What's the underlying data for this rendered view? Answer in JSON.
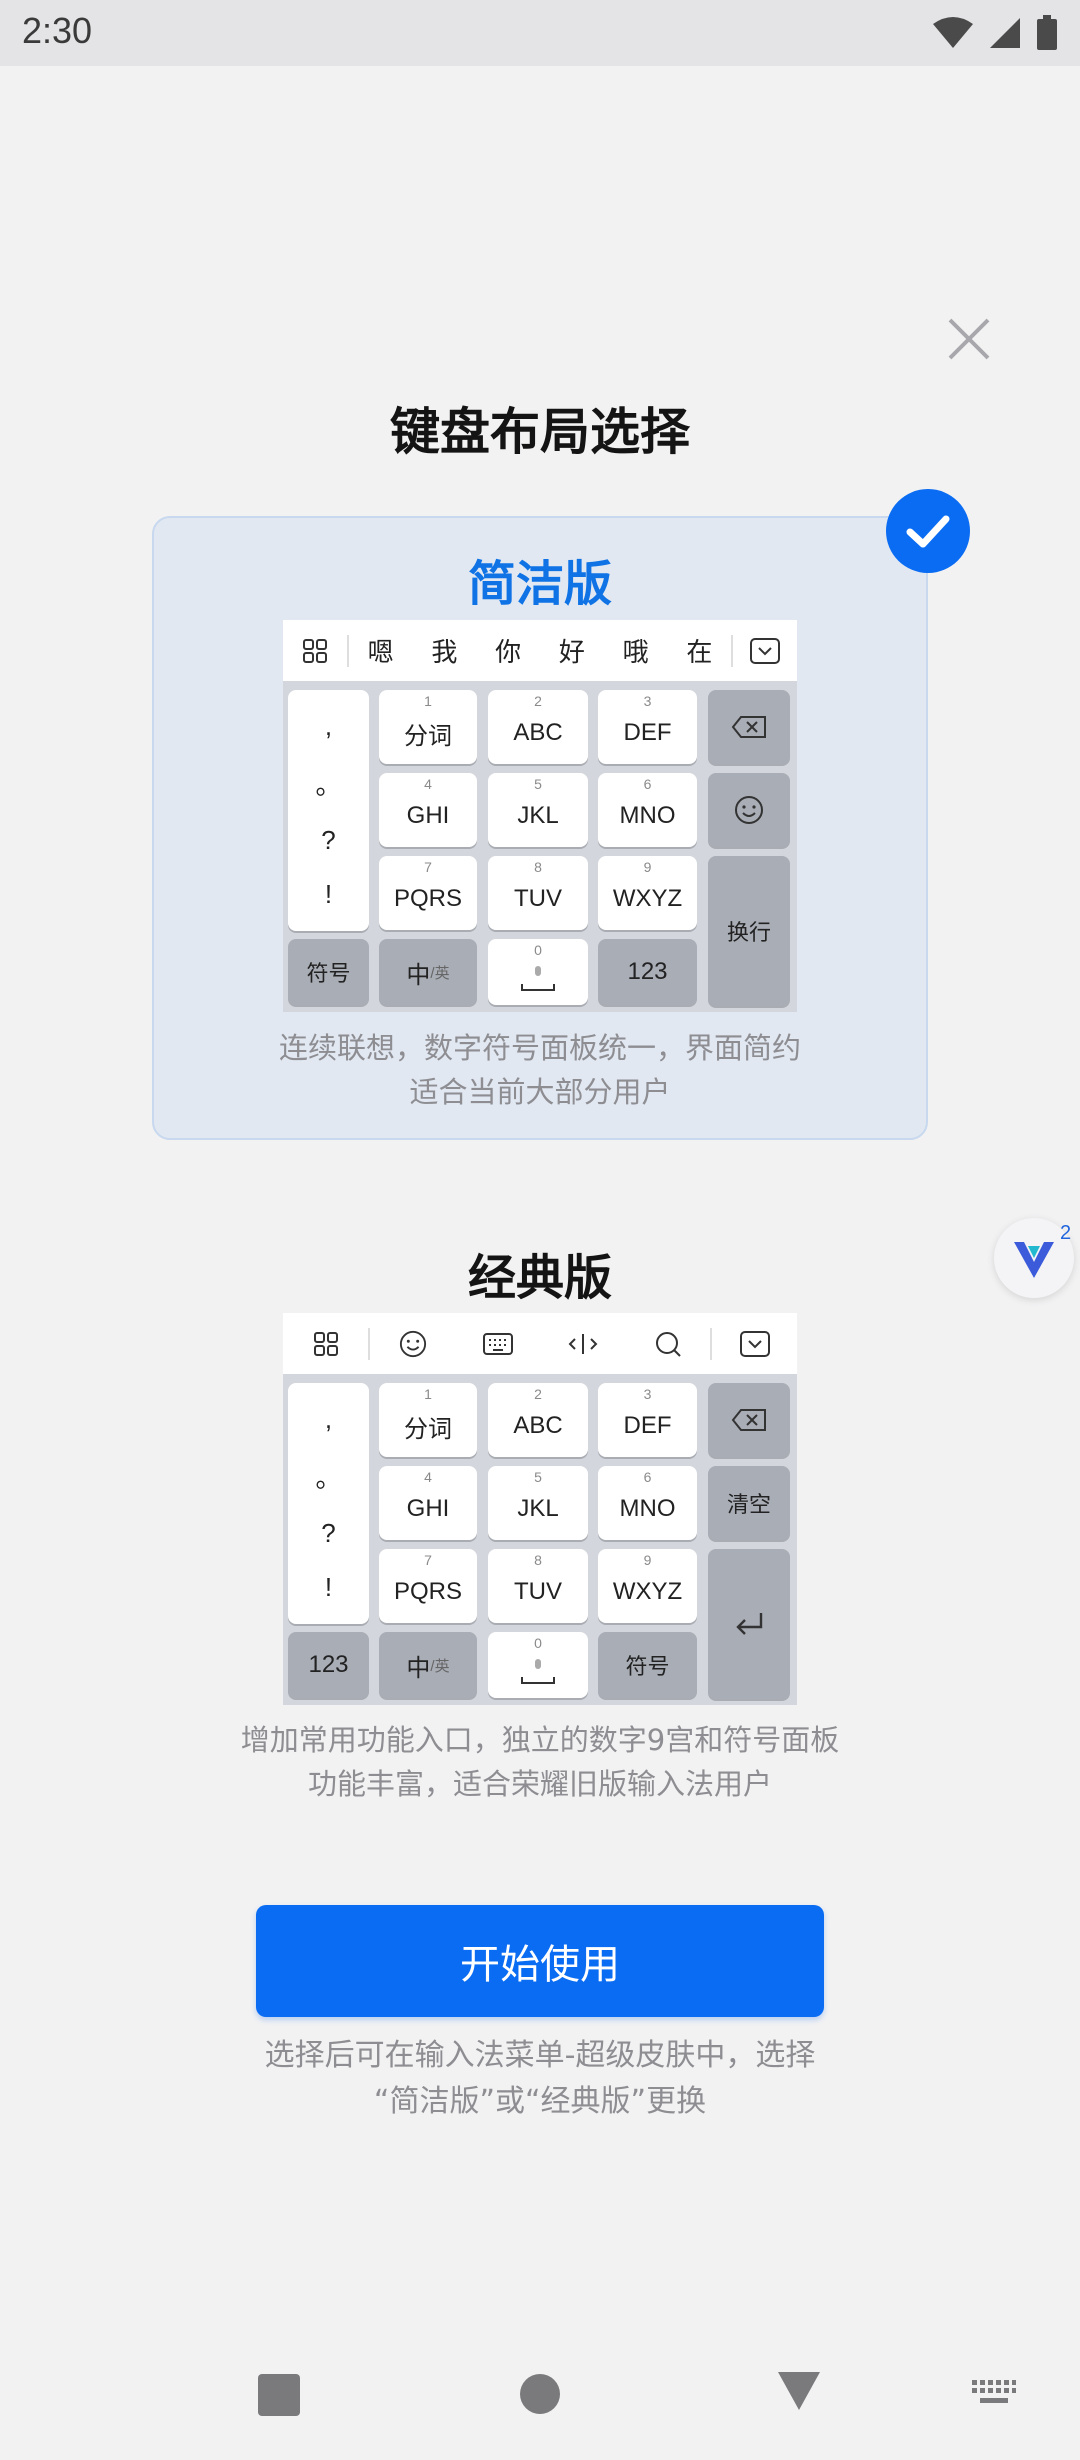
{
  "status": {
    "time": "2:30"
  },
  "dialog": {
    "title": "键盘布局选择",
    "start_button": "开始使用",
    "footer_line1": "选择后可在输入法菜单-超级皮肤中，选择",
    "footer_line2": "“简洁版”或“经典版”更换"
  },
  "simple": {
    "title": "简洁版",
    "selected": true,
    "desc_line1": "连续联想，数字符号面板统一，界面简约",
    "desc_line2": "适合当前大部分用户",
    "candidates": [
      "嗯",
      "我",
      "你",
      "好",
      "哦",
      "在"
    ],
    "punct": [
      ",",
      "。",
      "?",
      "!"
    ],
    "keys": [
      {
        "num": "1",
        "label": "分词"
      },
      {
        "num": "2",
        "label": "ABC"
      },
      {
        "num": "3",
        "label": "DEF"
      },
      {
        "num": "4",
        "label": "GHI"
      },
      {
        "num": "5",
        "label": "JKL"
      },
      {
        "num": "6",
        "label": "MNO"
      },
      {
        "num": "7",
        "label": "PQRS"
      },
      {
        "num": "8",
        "label": "TUV"
      },
      {
        "num": "9",
        "label": "WXYZ"
      }
    ],
    "bottom": {
      "symbol": "符号",
      "lang": "中",
      "lang_sub": "/英",
      "space_num": "0",
      "num": "123"
    },
    "enter": "换行"
  },
  "classic": {
    "title": "经典版",
    "desc_line1": "增加常用功能入口，独立的数字9宫和符号面板",
    "desc_line2": "功能丰富，适合荣耀旧版输入法用户",
    "punct": [
      ",",
      "。",
      "?",
      "!"
    ],
    "keys": [
      {
        "num": "1",
        "label": "分词"
      },
      {
        "num": "2",
        "label": "ABC"
      },
      {
        "num": "3",
        "label": "DEF"
      },
      {
        "num": "4",
        "label": "GHI"
      },
      {
        "num": "5",
        "label": "JKL"
      },
      {
        "num": "6",
        "label": "MNO"
      },
      {
        "num": "7",
        "label": "PQRS"
      },
      {
        "num": "8",
        "label": "TUV"
      },
      {
        "num": "9",
        "label": "WXYZ"
      }
    ],
    "clear": "清空",
    "bottom": {
      "num": "123",
      "lang": "中",
      "lang_sub": "/英",
      "space_num": "0",
      "symbol": "符号"
    }
  },
  "float": {
    "count": "2"
  },
  "colors": {
    "accent": "#0a6cf3",
    "selected_bg": "#e1e8f2",
    "desc": "#8d8d92"
  }
}
